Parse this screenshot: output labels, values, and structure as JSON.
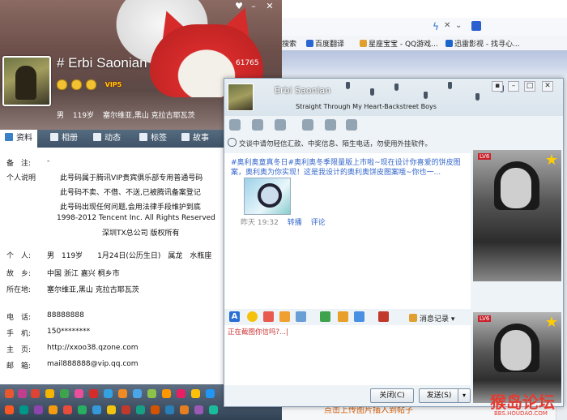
{
  "browser": {
    "favorites": [
      {
        "label": "搜索",
        "color": "#3a7bd5"
      },
      {
        "label": "百度翻译",
        "color": "#2a65d4"
      },
      {
        "label": "星座宝宝 - QQ游戏...",
        "color": "#e0a030"
      },
      {
        "label": "迅雷影视 - 找寻心...",
        "color": "#1a66cc"
      }
    ],
    "bottom_link": "点击上传图片插入到帖子"
  },
  "profile": {
    "nickname": "#   Erbi Saonian",
    "qq_number": "61765",
    "vip_label": "VIP5",
    "gender": "男",
    "age": "119岁",
    "location_short": "塞尔维亚,黑山 克拉古耶瓦茨",
    "tabs": [
      {
        "label": "资料",
        "active": true
      },
      {
        "label": "相册",
        "active": false
      },
      {
        "label": "动态",
        "active": false
      },
      {
        "label": "标签",
        "active": false
      },
      {
        "label": "故事",
        "active": false
      }
    ],
    "remark_label": "备　注:",
    "remark_value": "-",
    "desc_label": "个人说明",
    "desc_lines": [
      "此号码属于腾讯VIP贵宾俱乐部专用普通号码",
      "此号码不卖、不借、不送,已被腾讯备案登记",
      "此号码出现任何问题,会用法律手段维护到底",
      "1998-2012  Tencent Inc. All Rights Reserved",
      "深圳TX总公司 版权所有"
    ],
    "personal_label": "个　人:",
    "personal_value": "男　119岁　　1月24日(公历生日)　属龙　水瓶座",
    "hometown_label": "故　乡:",
    "hometown_value": "中国 浙江 嘉兴 桐乡市",
    "residence_label": "所在地:",
    "residence_value": "塞尔维亚,黑山 克拉古耶瓦茨",
    "phone_label": "电　话:",
    "phone_value": "88888888",
    "mobile_label": "手　机:",
    "mobile_value": "150********",
    "homepage_label": "主　页:",
    "homepage_value": "http://xxoo38.qzone.com",
    "email_label": "邮　箱:",
    "email_value": "mail888888@vip.qq.com"
  },
  "chat": {
    "name": "Erbi Saonian",
    "signature": "Straight Through My Heart-Backstreet Boys",
    "notice": "交谈中请勿轻信汇款、中奖信息、陌生电话，勿使用外挂软件。",
    "message_text": "#奥利奥童真冬日#奥利奥冬季限量版上市啦~现在设计你喜爱的饼皮图案，奥利奥为你实现！这是我设计的奥利奥饼皮图案哦~你也一...",
    "message_time": "昨天 19:32",
    "forward_label": "转播",
    "comment_label": "评论",
    "msg_record_label": "消息记录",
    "input_text": "正在截图你信吗?...|",
    "close_label": "关闭(C)",
    "send_label": "发送(S)",
    "lv_tag": "LV6"
  },
  "watermark": {
    "title": "猴岛论坛",
    "sub": "BBS.HOUDAO.COM"
  }
}
